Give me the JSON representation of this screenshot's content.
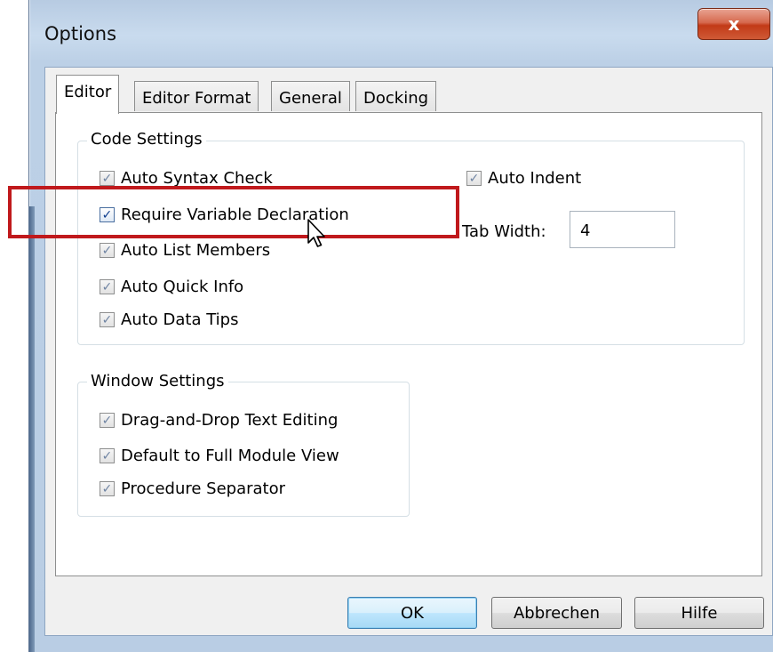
{
  "window": {
    "title": "Options",
    "close_glyph": "x"
  },
  "tabs": [
    {
      "label": "Editor",
      "active": true
    },
    {
      "label": "Editor Format",
      "active": false
    },
    {
      "label": "General",
      "active": false
    },
    {
      "label": "Docking",
      "active": false
    }
  ],
  "code_settings": {
    "legend": "Code Settings",
    "checkboxes": [
      {
        "label": "Auto Syntax Check",
        "checked": true
      },
      {
        "label": "Require Variable Declaration",
        "checked": true
      },
      {
        "label": "Auto List Members",
        "checked": true
      },
      {
        "label": "Auto Quick Info",
        "checked": true
      },
      {
        "label": "Auto Data Tips",
        "checked": true
      },
      {
        "label": "Auto Indent",
        "checked": true
      }
    ],
    "tab_width_label": "Tab Width:",
    "tab_width_value": "4"
  },
  "window_settings": {
    "legend": "Window Settings",
    "checkboxes": [
      {
        "label": "Drag-and-Drop Text Editing",
        "checked": true
      },
      {
        "label": "Default to Full Module View",
        "checked": true
      },
      {
        "label": "Procedure Separator",
        "checked": true
      }
    ]
  },
  "buttons": {
    "ok": "OK",
    "cancel": "Abbrechen",
    "help": "Hilfe"
  },
  "check_glyph": "✓",
  "colors": {
    "highlight": "#c0191c",
    "default_button_border": "#3c7fb1",
    "close_button": "#c23a17"
  },
  "icons": {
    "close": "close-icon",
    "cursor": "mouse-cursor-icon",
    "check": "checkmark-icon"
  }
}
